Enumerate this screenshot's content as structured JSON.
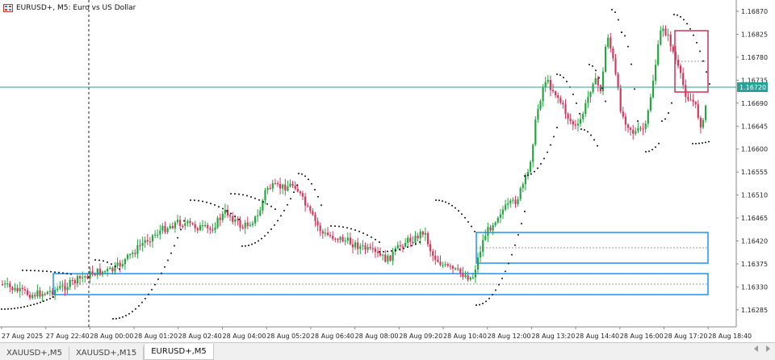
{
  "window": {
    "symbol_title": "EURUSD+, M5:  Euro vs US Dollar"
  },
  "price_axis": {
    "labels": [
      "1.16870",
      "1.16825",
      "1.16780",
      "1.16735",
      "1.16690",
      "1.16645",
      "1.16600",
      "1.16555",
      "1.16510",
      "1.16465",
      "1.16420",
      "1.16375",
      "1.16330",
      "1.16285"
    ],
    "current_price": "1.16720",
    "current_price_color": "#2aa198"
  },
  "time_axis": {
    "labels": [
      "27 Aug 2025",
      "27 Aug 22:40",
      "28 Aug 00:00",
      "28 Aug 01:20",
      "28 Aug 02:40",
      "28 Aug 04:00",
      "28 Aug 05:20",
      "28 Aug 06:40",
      "28 Aug 08:00",
      "28 Aug 09:20",
      "28 Aug 10:40",
      "28 Aug 12:00",
      "28 Aug 13:20",
      "28 Aug 14:40",
      "28 Aug 16:00",
      "28 Aug 17:20",
      "28 Aug 18:40"
    ]
  },
  "colors": {
    "bull": "#26a641",
    "bear": "#d6375d",
    "zone": "#1e90ff",
    "box": "#cc3355",
    "sar": "#111111"
  },
  "tabs": [
    {
      "label": "XAUUSD+,M5",
      "active": false
    },
    {
      "label": "XAUUSD+,M15",
      "active": false
    },
    {
      "label": "EURUSD+,M5",
      "active": true
    }
  ]
}
